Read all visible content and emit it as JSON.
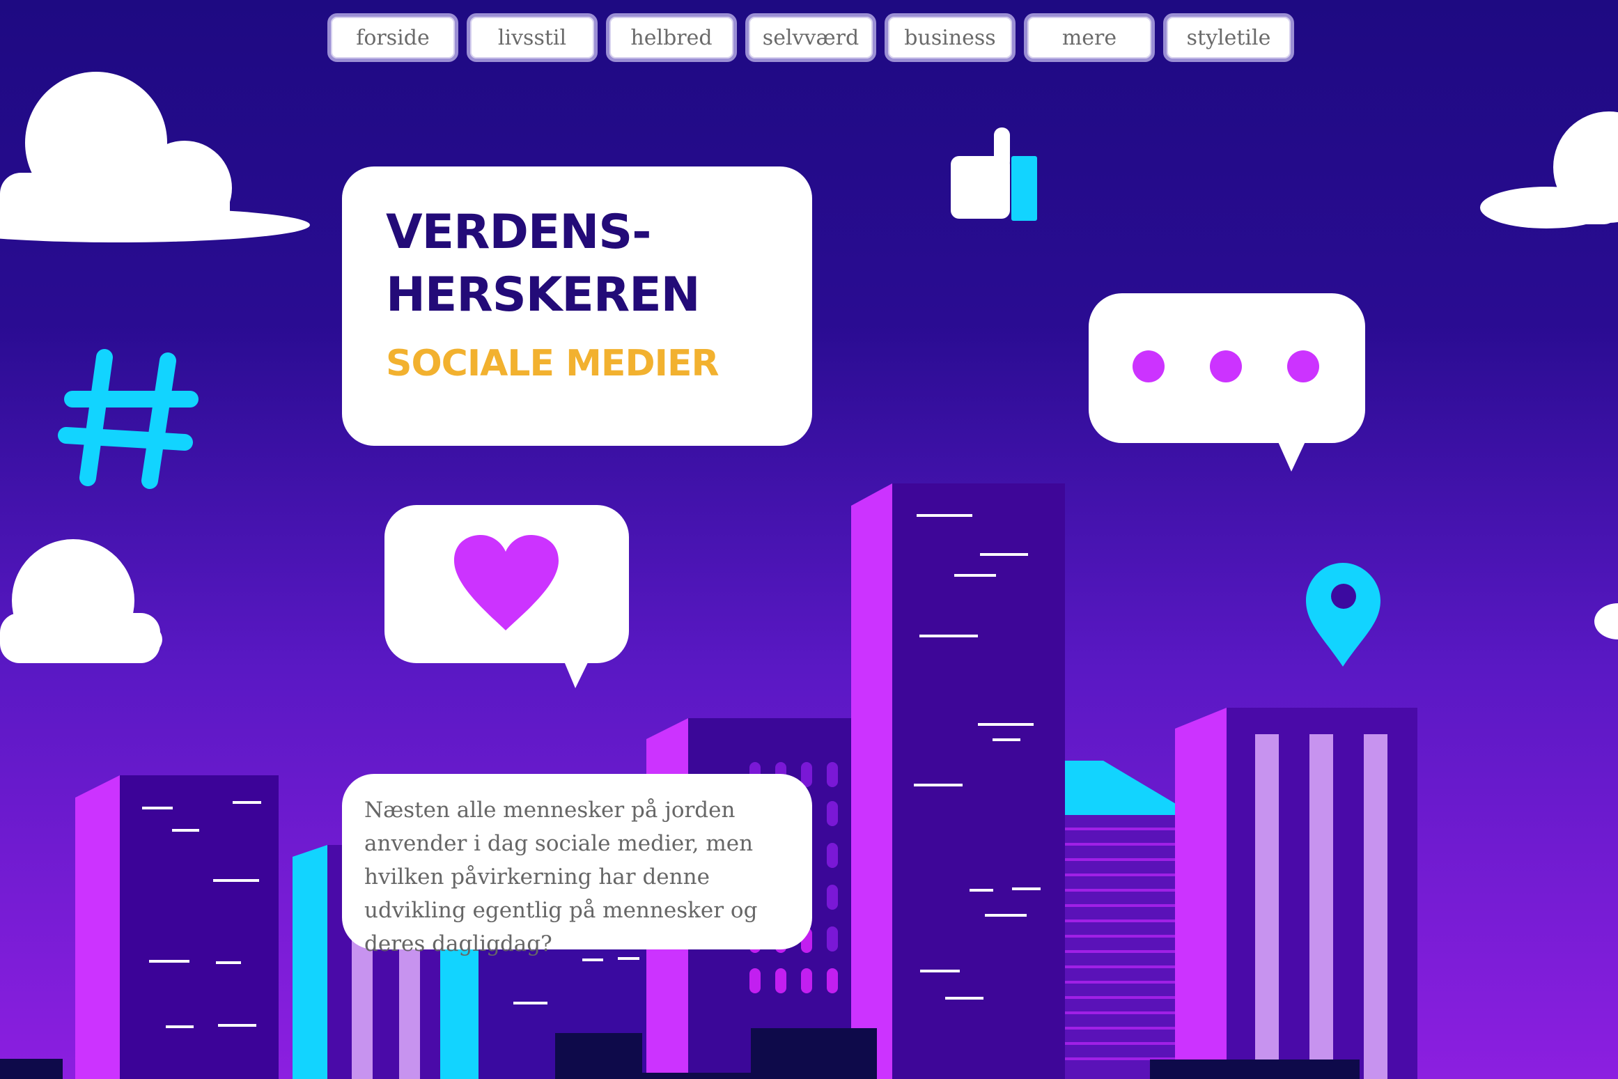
{
  "nav": {
    "items": [
      {
        "label": "forside"
      },
      {
        "label": "livsstil"
      },
      {
        "label": "helbred"
      },
      {
        "label": "selvværd"
      },
      {
        "label": "business"
      },
      {
        "label": "mere"
      },
      {
        "label": "styletile"
      }
    ]
  },
  "hero": {
    "title_line1": "VERDENS-",
    "title_line2": "HERSKEREN",
    "subtitle": "SOCIALE MEDIER"
  },
  "intro": {
    "text": "Næsten alle mennesker på jorden anvender i dag sociale medier, men hvilken påvirkerning har denne udvikling egentlig på mennesker og deres dagligdag?"
  },
  "colors": {
    "navy": "#230b78",
    "gold": "#f2b12f",
    "magenta": "#cc33ff",
    "cyan": "#12d4ff",
    "bg_top": "#1e0a82",
    "bg_bottom": "#8c1fe0"
  },
  "icons": [
    "hashtag-icon",
    "thumbs-up-icon",
    "typing-bubble-icon",
    "heart-bubble-icon",
    "location-pin-icon",
    "cloud-icon"
  ]
}
